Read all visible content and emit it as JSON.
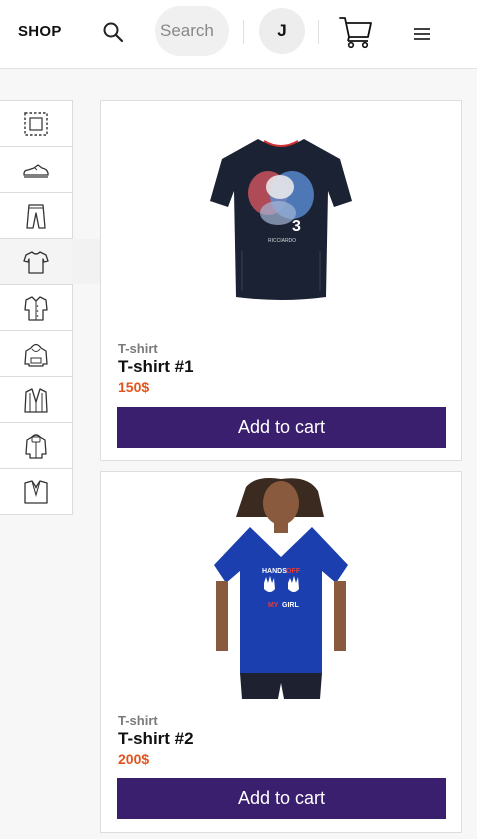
{
  "header": {
    "logo": "SHOP",
    "search_placeholder": "Search",
    "avatar_initial": "J"
  },
  "sidebar": {
    "categories": [
      {
        "icon": "all-categories-icon"
      },
      {
        "icon": "sneaker-icon"
      },
      {
        "icon": "pants-icon"
      },
      {
        "icon": "tshirt-icon",
        "active": true
      },
      {
        "icon": "shirt-icon"
      },
      {
        "icon": "hoodie-icon"
      },
      {
        "icon": "blazer-icon"
      },
      {
        "icon": "jacket-icon"
      },
      {
        "icon": "suit-icon"
      }
    ]
  },
  "products": [
    {
      "category": "T-shirt",
      "title": "T-shirt #1",
      "price": "150$",
      "button": "Add to cart",
      "image": "black-tshirt-image",
      "color": "#1b2233"
    },
    {
      "category": "T-shirt",
      "title": "T-shirt #2",
      "price": "200$",
      "button": "Add to cart",
      "image": "blue-tshirt-model-image",
      "color": "#1b3fae"
    }
  ],
  "colors": {
    "accent": "#3a1f6f",
    "price": "#e2541e"
  }
}
